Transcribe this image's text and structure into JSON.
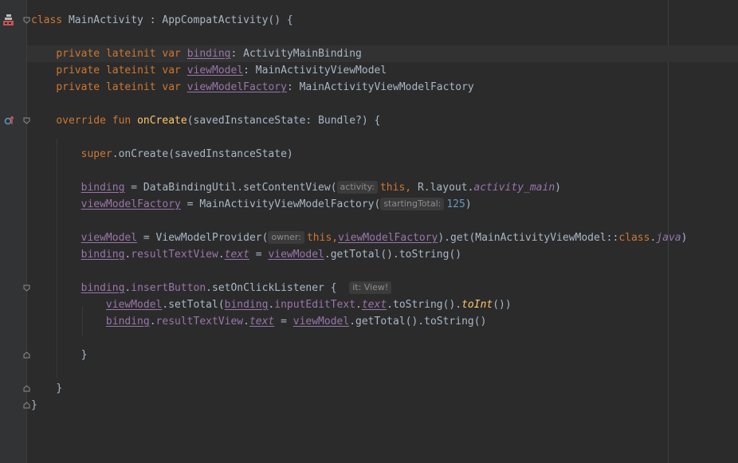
{
  "colors": {
    "background": "#2b2b2b",
    "gutter": "#313335",
    "keyword": "#cc7832",
    "text": "#a9b7c6",
    "function": "#ffc66d",
    "property": "#9876aa",
    "number": "#6897bb",
    "hint_background": "#3b3b3b",
    "hint_text": "#8c8c8c"
  },
  "gutter_icons": {
    "class_marker": "android-activity-icon",
    "override_marker": "override-method-icon"
  },
  "code": {
    "l1": {
      "kw": "class",
      "rest": " MainActivity : AppCompatActivity() {"
    },
    "l2": {
      "p1": "private",
      "p2": "lateinit",
      "p3": "var",
      "name": "binding",
      "type": ": ActivityMainBinding"
    },
    "l3": {
      "p1": "private",
      "p2": "lateinit",
      "p3": "var",
      "name": "viewModel",
      "type": ": MainActivityViewModel"
    },
    "l4": {
      "p1": "private",
      "p2": "lateinit",
      "p3": "var",
      "name": "viewModelFactory",
      "type": ": MainActivityViewModelFactory"
    },
    "l5": {
      "kw1": "override",
      "kw2": "fun",
      "fn": "onCreate",
      "rest": "(savedInstanceState: Bundle?) {"
    },
    "l6": {
      "kw": "super",
      "rest": ".onCreate(savedInstanceState)"
    },
    "l7": {
      "name": "binding",
      "mid": " = DataBindingUtil.setContentView(",
      "hint": "activity:",
      "this_kw": "this,",
      "rlayout": " R.layout.",
      "field": "activity_main",
      "end": ")"
    },
    "l8": {
      "name": "viewModelFactory",
      "mid": " = MainActivityViewModelFactory(",
      "hint": "startingTotal:",
      "num": "125",
      "end": ")"
    },
    "l9": {
      "name": "viewModel",
      "mid": " = ViewModelProvider(",
      "hint": "owner:",
      "this_kw": "this,",
      "arg": "viewModelFactory",
      "get": ").get(MainActivityViewModel::",
      "class_kw": "class",
      "dot": ".",
      "java": "java",
      "end": ")"
    },
    "l10": {
      "name": "binding",
      "dot1": ".",
      "prop": "resultTextView",
      "dot2": ".",
      "text": "text",
      "eq": " = ",
      "vm": "viewModel",
      "end": ".getTotal().toString()"
    },
    "l11": {
      "name": "binding",
      "dot1": ".",
      "prop": "insertButton",
      "mid": ".setOnClickListener {",
      "hint": "it: View!"
    },
    "l12": {
      "vm": "viewModel",
      "mid": ".setTotal(",
      "b": "binding",
      "dot1": ".",
      "prop": "inputEditText",
      "dot2": ".",
      "text": "text",
      "ts": ".toString().",
      "toint": "toInt",
      "end": "())"
    },
    "l13": {
      "name": "binding",
      "dot1": ".",
      "prop": "resultTextView",
      "dot2": ".",
      "text": "text",
      "eq": " = ",
      "vm": "viewModel",
      "end": ".getTotal().toString()"
    },
    "l14": {
      "brace": "}"
    },
    "l15": {
      "brace": "}"
    },
    "l16": {
      "brace": "}"
    }
  }
}
